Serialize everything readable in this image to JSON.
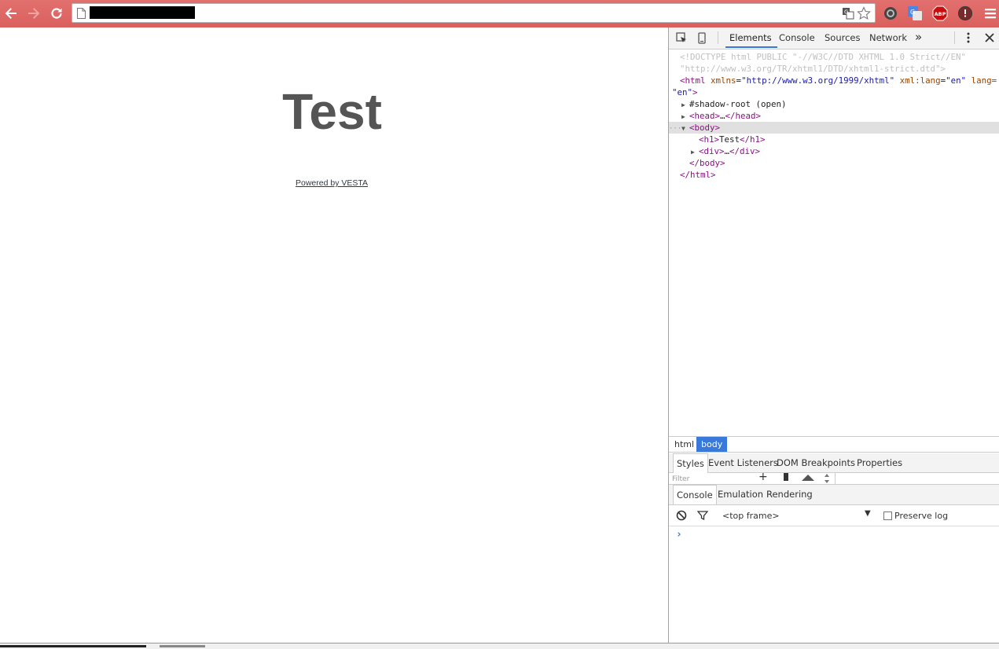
{
  "browser": {
    "url": "",
    "accent_color": "#d9605d",
    "nav_icons": [
      "back-arrow-icon",
      "forward-arrow-icon",
      "reload-icon"
    ],
    "omnibox_icons": [
      "page-icon",
      "translate-icon",
      "star-icon"
    ],
    "extensions": [
      "shield-extension-icon",
      "google-translate-extension-icon",
      "adblock-plus-icon",
      "warning-extension-icon",
      "chrome-menu-icon"
    ],
    "abp_label": "ABP"
  },
  "page": {
    "heading": "Test",
    "link_text": "Powered by VESTA"
  },
  "devtools": {
    "tabs": [
      "Elements",
      "Console",
      "Sources",
      "Network"
    ],
    "more_tabs_glyph": "»",
    "active_tab": "Elements",
    "dom_lines": {
      "doctype_1": "<!DOCTYPE html PUBLIC \"-//W3C//DTD XHTML 1.0 Strict//EN\"",
      "doctype_2": "\"http://www.w3.org/TR/xhtml1/DTD/xhtml1-strict.dtd\">",
      "html_open": "<html",
      "html_attr1_name": "xmlns",
      "html_attr1_val": "\"http://www.w3.org/1999/xhtml\"",
      "html_attr2_name": "xml:lang",
      "html_attr2_val": "\"en\"",
      "html_attr3_name": "lang=",
      "html_attr3_wrap": "\"en\"",
      "gt": ">",
      "shadow_root": "#shadow-root (open)",
      "head_open": "<head>",
      "ellipsis": "…",
      "head_close": "</head>",
      "dots": "···",
      "body_open": "<body>",
      "h1_open": "<h1>",
      "h1_text": "Test",
      "h1_close": "</h1>",
      "div_open": "<div>",
      "div_close": "</div>",
      "body_close": "</body>",
      "html_close": "</html>"
    },
    "breadcrumbs": [
      "html",
      "body"
    ],
    "style_tabs": [
      "Styles",
      "Event Listeners",
      "DOM Breakpoints",
      "Properties"
    ],
    "styles_filter_placeholder": "Filter",
    "drawer_tabs": [
      "Console",
      "Emulation",
      "Rendering"
    ],
    "frame_selector": "<top frame>",
    "preserve_log_label": "Preserve log",
    "preserve_log_checked": false,
    "prompt_glyph": "›",
    "accent_color": "#3879d9"
  }
}
